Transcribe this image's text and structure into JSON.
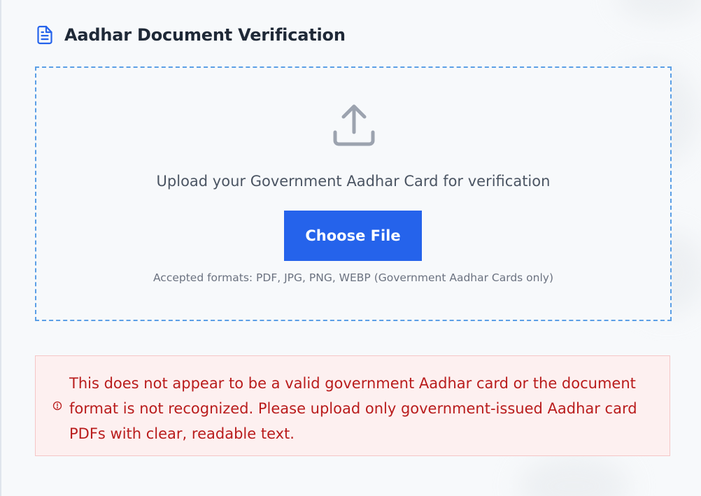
{
  "header": {
    "title": "Aadhar Document Verification",
    "icon": "document-icon"
  },
  "upload": {
    "icon": "upload-icon",
    "prompt": "Upload your Government Aadhar Card for verification",
    "button_label": "Choose File",
    "accepted_formats": "Accepted formats: PDF, JPG, PNG, WEBP (Government Aadhar Cards only)"
  },
  "error": {
    "icon": "alert-circle-icon",
    "message": "This does not appear to be a valid government Aadhar card or the document format is not recognized. Please upload only government-issued Aadhar card PDFs with clear, readable text."
  },
  "colors": {
    "accent": "#2563eb",
    "dropzone_border": "#5b9fe6",
    "error_text": "#b91c1c",
    "error_background": "#fdf0f0",
    "error_border": "#f5c6c6"
  }
}
